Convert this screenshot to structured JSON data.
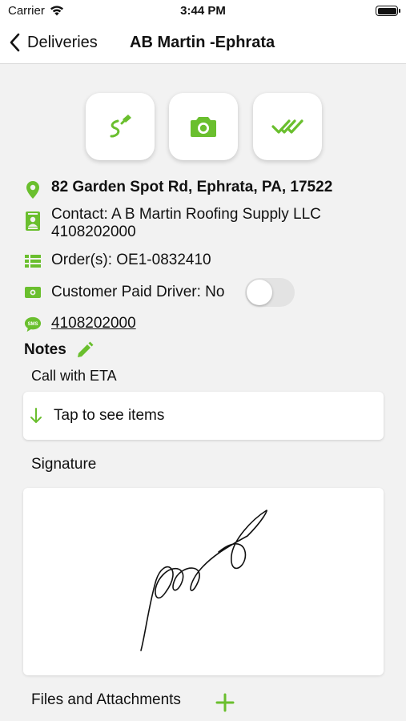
{
  "status_bar": {
    "carrier": "Carrier",
    "time": "3:44 PM"
  },
  "nav": {
    "back_label": "Deliveries",
    "title": "AB Martin -Ephrata"
  },
  "actions": [
    {
      "icon": "signature-icon"
    },
    {
      "icon": "camera-icon"
    },
    {
      "icon": "double-check-icon"
    }
  ],
  "details": {
    "address": "82 Garden Spot Rd, Ephrata, PA, 17522",
    "contact_line1": "Contact: A B Martin Roofing Supply LLC",
    "contact_line2": "4108202000",
    "orders": "Order(s): OE1-0832410",
    "customer_paid": "Customer Paid Driver: No",
    "customer_paid_value": false,
    "sms_phone": "4108202000"
  },
  "notes": {
    "heading": "Notes",
    "text": "Call with ETA"
  },
  "items": {
    "label": "Tap to see items"
  },
  "signature": {
    "label": "Signature"
  },
  "files": {
    "label": "Files and Attachments"
  },
  "colors": {
    "accent": "#6abf2e",
    "background": "#f2f2f2"
  }
}
